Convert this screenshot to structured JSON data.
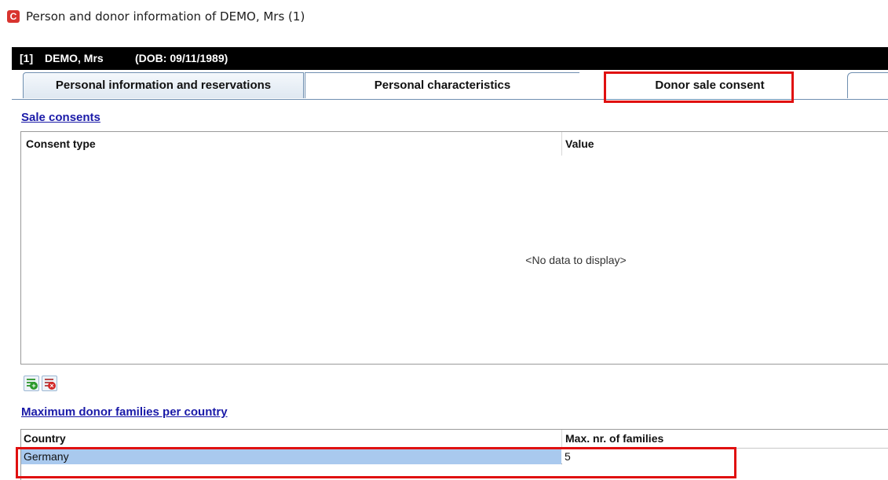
{
  "window": {
    "title": "Person and donor information of DEMO, Mrs (1)",
    "icon": "app-logo-icon"
  },
  "header": {
    "id": "[1]",
    "name": "DEMO, Mrs",
    "dob": "(DOB: 09/11/1989)"
  },
  "tabs": [
    {
      "label": "Personal information and reservations"
    },
    {
      "label": "Personal characteristics"
    },
    {
      "label": "Donor sale consent",
      "active": true
    },
    {
      "label": ""
    }
  ],
  "sale_consents": {
    "title": "Sale consents",
    "columns": [
      "Consent type",
      "Value"
    ],
    "empty_text": "<No data to display>",
    "buttons": [
      {
        "name": "add-row-icon"
      },
      {
        "name": "delete-row-icon"
      }
    ]
  },
  "max_families": {
    "title": "Maximum donor families per country",
    "columns": [
      "Country",
      "Max. nr. of families"
    ],
    "rows": [
      {
        "country": "Germany",
        "max": "5"
      }
    ]
  },
  "colors": {
    "highlight": "#e01010",
    "selected_row": "#a9c9ee",
    "link": "#1a1aa8",
    "header_bg": "#000000"
  }
}
